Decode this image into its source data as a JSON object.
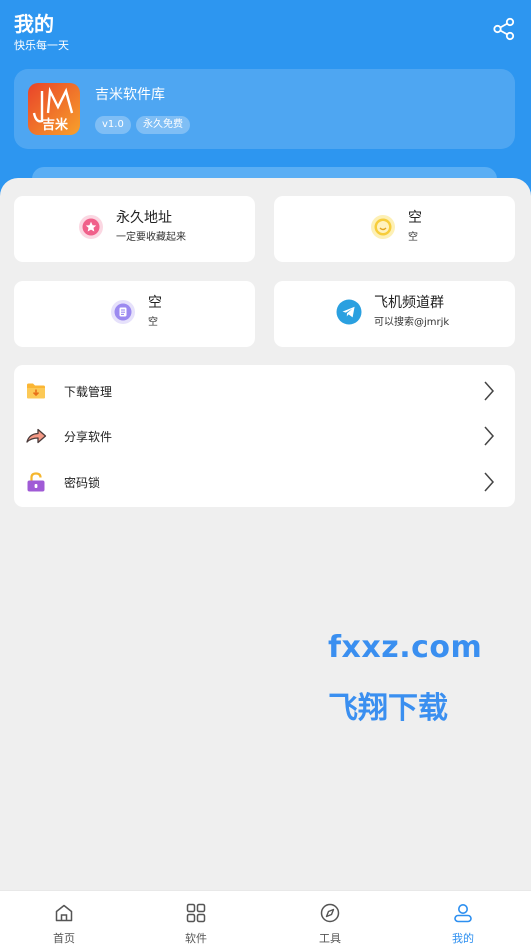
{
  "header": {
    "title": "我的",
    "subtitle": "快乐每一天",
    "share_icon": "share-icon"
  },
  "app": {
    "name": "吉米软件库",
    "version": "v1.0",
    "license": "永久免费",
    "logo_text": "吉米",
    "logo_colors": [
      "#e9432a",
      "#f7a12b"
    ]
  },
  "tiles": [
    {
      "title": "永久地址",
      "subtitle": "一定要收藏起来",
      "icon": "star-badge-icon"
    },
    {
      "title": "空",
      "subtitle": "空",
      "icon": "smiley-coin-icon"
    },
    {
      "title": "空",
      "subtitle": "空",
      "icon": "receipt-badge-icon"
    },
    {
      "title": "飞机频道群",
      "subtitle": "可以搜索@jmrjk",
      "icon": "telegram-icon"
    }
  ],
  "menu": [
    {
      "label": "下载管理",
      "icon": "download-folder-icon"
    },
    {
      "label": "分享软件",
      "icon": "share-arrow-icon"
    },
    {
      "label": "密码锁",
      "icon": "padlock-icon"
    }
  ],
  "watermark": {
    "line1": "fxxz.com",
    "line2": "飞翔下载"
  },
  "tabs": [
    {
      "label": "首页",
      "icon": "home-icon"
    },
    {
      "label": "软件",
      "icon": "grid-icon"
    },
    {
      "label": "工具",
      "icon": "compass-icon"
    },
    {
      "label": "我的",
      "icon": "person-icon",
      "active": true
    }
  ],
  "colors": {
    "header_blue": "#2d96f0",
    "active_tab": "#2d8ff0",
    "watermark": "#3a8ff0"
  }
}
